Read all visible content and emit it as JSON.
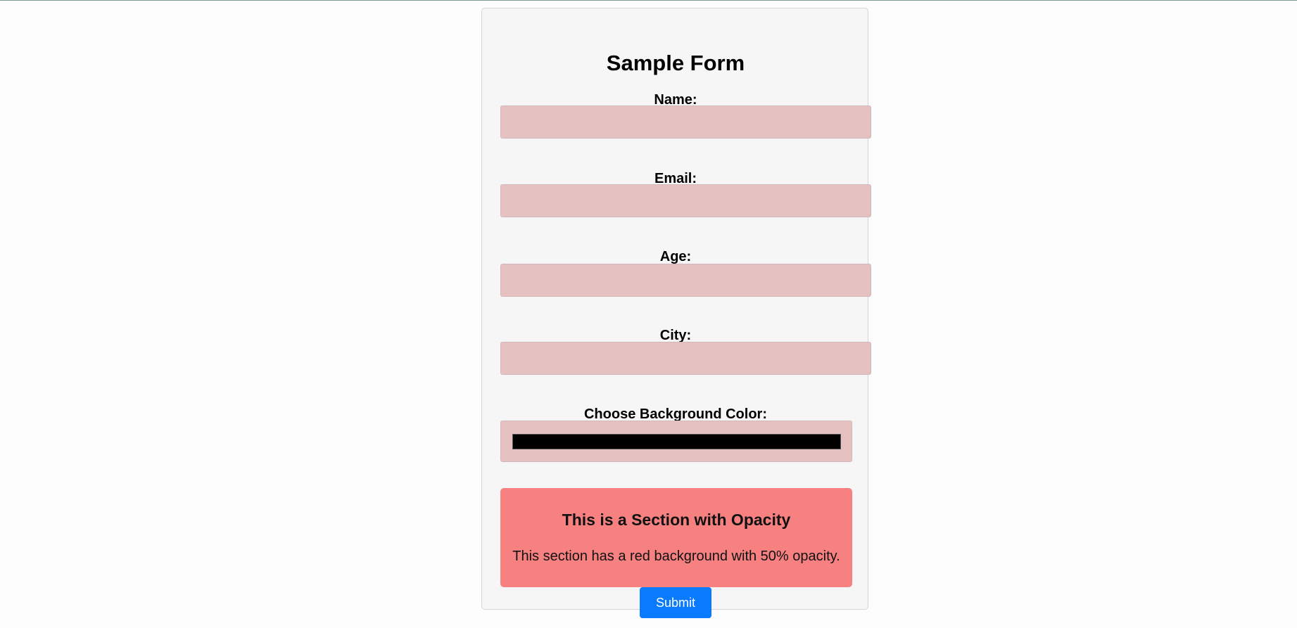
{
  "form": {
    "title": "Sample Form",
    "fields": [
      {
        "label": "Name:",
        "value": "",
        "placeholder": ""
      },
      {
        "label": "Email:",
        "value": "",
        "placeholder": ""
      },
      {
        "label": "Age:",
        "value": "",
        "placeholder": ""
      },
      {
        "label": "City:",
        "value": "",
        "placeholder": ""
      }
    ],
    "color_picker": {
      "label": "Choose Background Color:",
      "value": "#000000"
    },
    "opacity_section": {
      "title": "This is a Section with Opacity",
      "text": "This section has a red background with 50% opacity."
    },
    "submit_label": "Submit"
  },
  "colors": {
    "input_background": "#e6c1c2",
    "section_background": "#f74040",
    "submit_background": "#0a7bff"
  }
}
